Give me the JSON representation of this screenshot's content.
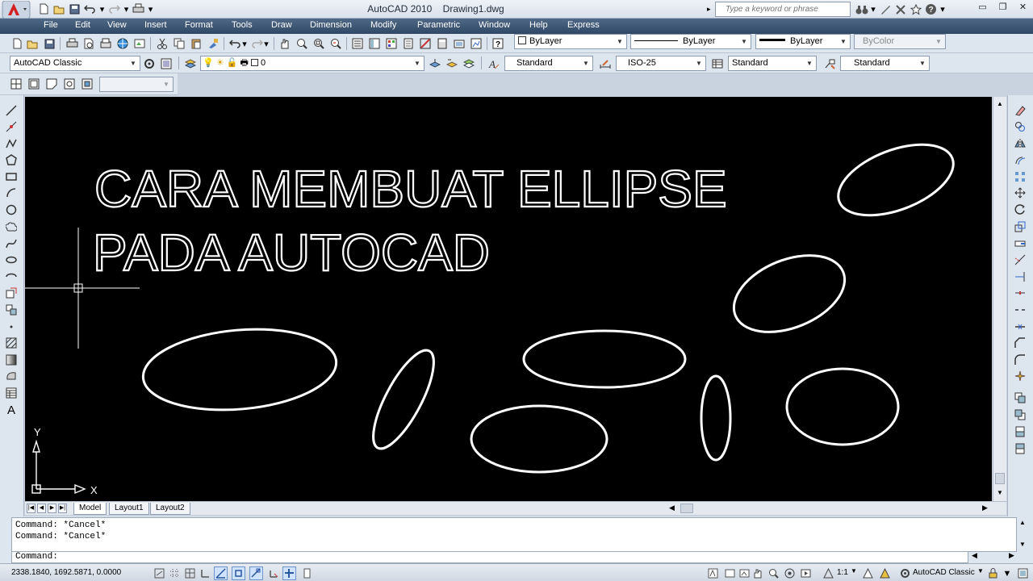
{
  "titlebar": {
    "app_name": "AutoCAD 2010",
    "file_name": "Drawing1.dwg",
    "search_placeholder": "Type a keyword or phrase"
  },
  "menu": [
    "File",
    "Edit",
    "View",
    "Insert",
    "Format",
    "Tools",
    "Draw",
    "Dimension",
    "Modify",
    "Parametric",
    "Window",
    "Help",
    "Express"
  ],
  "properties": {
    "color": "ByLayer",
    "linetype": "ByLayer",
    "lineweight": "ByLayer",
    "plotstyle": "ByColor"
  },
  "workspace": "AutoCAD Classic",
  "layer": "0",
  "styles": {
    "text_style": "Standard",
    "dim_style": "ISO-25",
    "table_style": "Standard",
    "mleader_style": "Standard"
  },
  "drawing": {
    "title_line1": "CARA MEMBUAT ELLIPSE",
    "title_line2": "PADA AUTOCAD",
    "ucs_x": "X",
    "ucs_y": "Y",
    "line_color": "#ffffff",
    "background": "#000000"
  },
  "tabs": [
    "Model",
    "Layout1",
    "Layout2"
  ],
  "command": {
    "history": [
      "Command: *Cancel*",
      "Command: *Cancel*"
    ],
    "prompt": "Command:"
  },
  "status": {
    "coordinates": "2338.1840, 1692.5871, 0.0000",
    "annotation_scale": "1:1",
    "workspace": "AutoCAD Classic"
  },
  "colors": {
    "menubar": "#34506f",
    "toolbar_bg": "#dde5ef",
    "canvas": "#000000"
  }
}
